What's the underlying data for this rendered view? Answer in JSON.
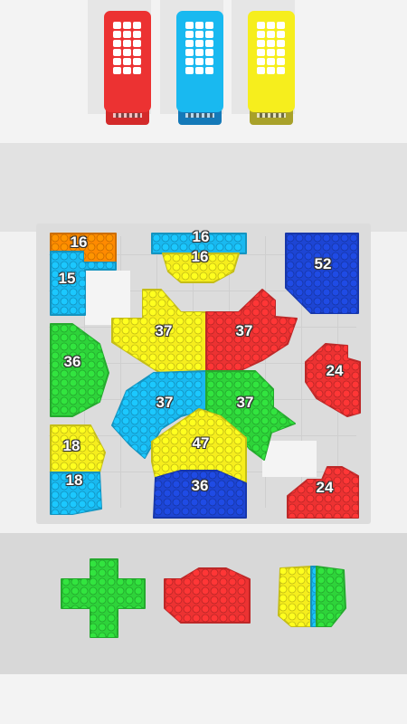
{
  "colors": {
    "red": "#ec3232",
    "blue": "#19b9f0",
    "yellow": "#f6ee1d",
    "green": "#2ed33a",
    "orange": "#ff8a00",
    "navy": "#1d45d4"
  },
  "buses": [
    {
      "name": "red-bus",
      "color": "red",
      "base": "#d32a2a"
    },
    {
      "name": "blue-bus",
      "color": "blue",
      "base": "#1479b8"
    },
    {
      "name": "yellow-bus",
      "color": "yellow",
      "base": "#a8a12a"
    }
  ],
  "board_counts": [
    {
      "id": "orange-top-left",
      "label": "16"
    },
    {
      "id": "blue-top-left",
      "label": "15"
    },
    {
      "id": "blue-top-center",
      "label": "16"
    },
    {
      "id": "yellow-top-center",
      "label": "16"
    },
    {
      "id": "navy-top-right",
      "label": "52"
    },
    {
      "id": "green-left",
      "label": "36"
    },
    {
      "id": "yellow-star-left",
      "label": "37"
    },
    {
      "id": "red-star-right",
      "label": "37"
    },
    {
      "id": "red-right",
      "label": "24"
    },
    {
      "id": "blue-star-lower-left",
      "label": "37"
    },
    {
      "id": "green-star-lower-right",
      "label": "37"
    },
    {
      "id": "yellow-lower-left",
      "label": "18"
    },
    {
      "id": "blue-lower-left",
      "label": "18"
    },
    {
      "id": "yellow-house",
      "label": "47"
    },
    {
      "id": "navy-house",
      "label": "36"
    },
    {
      "id": "red-bottom-right",
      "label": "24"
    }
  ],
  "tray": [
    {
      "name": "tray-green-cross",
      "colors": [
        "green"
      ]
    },
    {
      "name": "tray-red-arrow",
      "colors": [
        "red"
      ]
    },
    {
      "name": "tray-yellow-blue-block",
      "colors": [
        "yellow",
        "blue"
      ]
    }
  ]
}
